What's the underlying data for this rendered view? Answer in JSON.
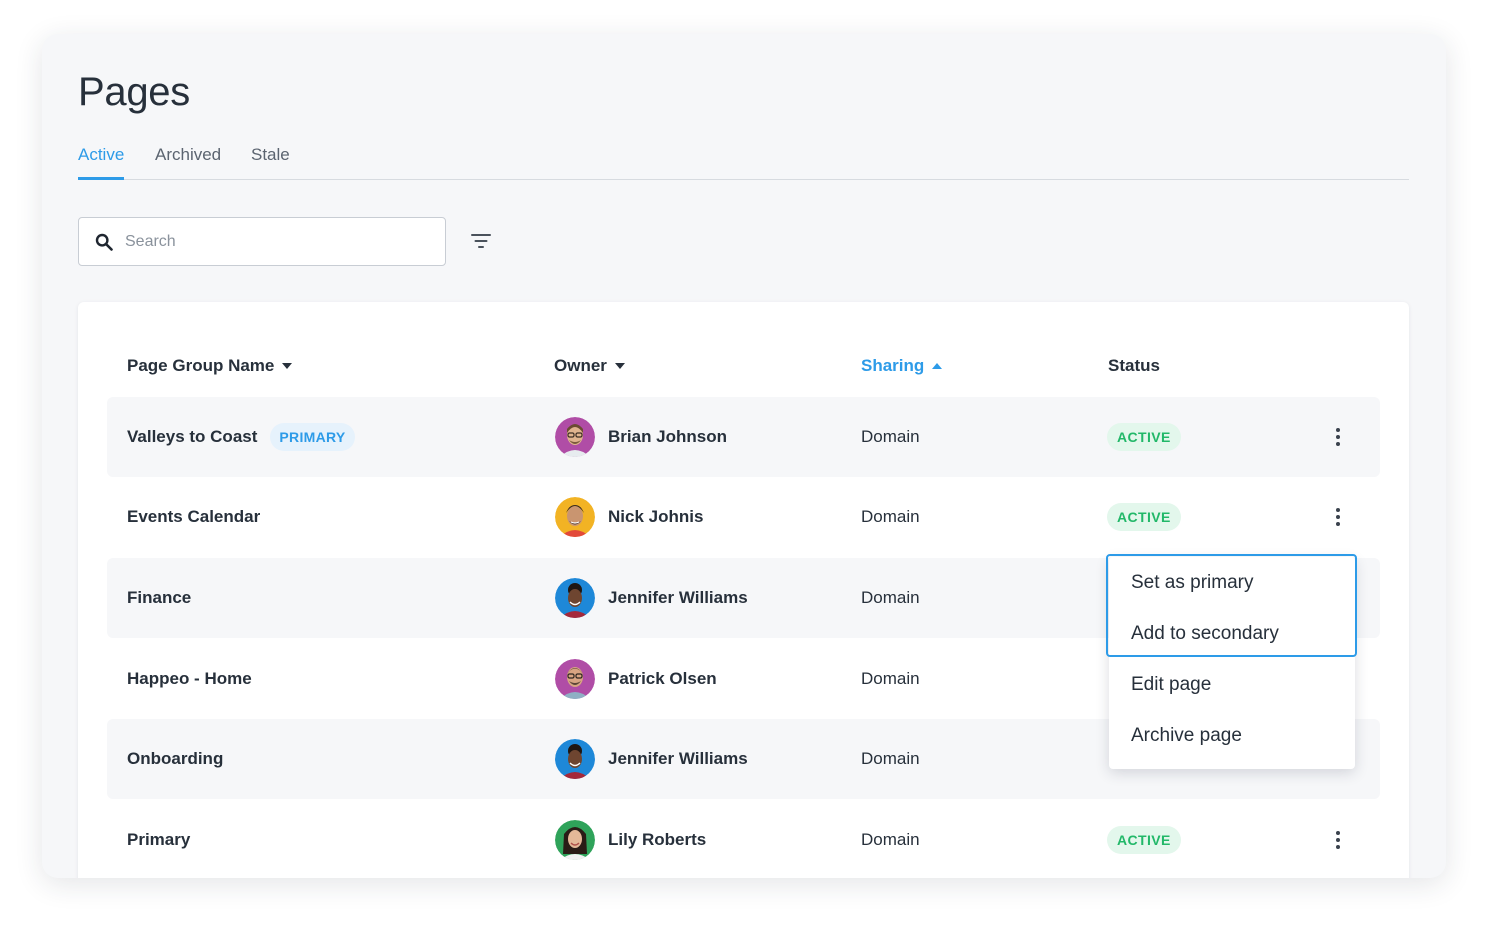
{
  "page": {
    "title": "Pages"
  },
  "tabs": [
    {
      "label": "Active",
      "active": true
    },
    {
      "label": "Archived",
      "active": false
    },
    {
      "label": "Stale",
      "active": false
    }
  ],
  "search": {
    "placeholder": "Search",
    "value": "",
    "icon": "search-icon"
  },
  "filter": {
    "icon": "filter-icon"
  },
  "table": {
    "columns": {
      "name": "Page Group Name",
      "owner": "Owner",
      "sharing": "Sharing",
      "status": "Status"
    },
    "sort": {
      "column": "Sharing",
      "direction": "ascending"
    },
    "rows": [
      {
        "name": "Valleys to Coast",
        "badge": "PRIMARY",
        "owner": "Brian Johnson",
        "sharing": "Domain",
        "status": "ACTIVE"
      },
      {
        "name": "Events Calendar",
        "badge": "",
        "owner": "Nick Johnis",
        "sharing": "Domain",
        "status": "ACTIVE"
      },
      {
        "name": "Finance",
        "badge": "",
        "owner": "Jennifer Williams",
        "sharing": "Domain",
        "status": ""
      },
      {
        "name": "Happeo - Home",
        "badge": "",
        "owner": "Patrick Olsen",
        "sharing": "Domain",
        "status": ""
      },
      {
        "name": "Onboarding",
        "badge": "",
        "owner": "Jennifer Williams",
        "sharing": "Domain",
        "status": ""
      },
      {
        "name": "Primary",
        "badge": "",
        "owner": "Lily Roberts",
        "sharing": "Domain",
        "status": "ACTIVE"
      }
    ]
  },
  "context_menu": {
    "items": [
      "Set as primary",
      "Add to secondary",
      "Edit page",
      "Archive page"
    ]
  },
  "colors": {
    "accent": "#2d9be8",
    "status_active": "#22b869",
    "status_active_bg": "#e3f7ec",
    "badge_primary_bg": "#e6f2fc",
    "text": "#27303b"
  }
}
